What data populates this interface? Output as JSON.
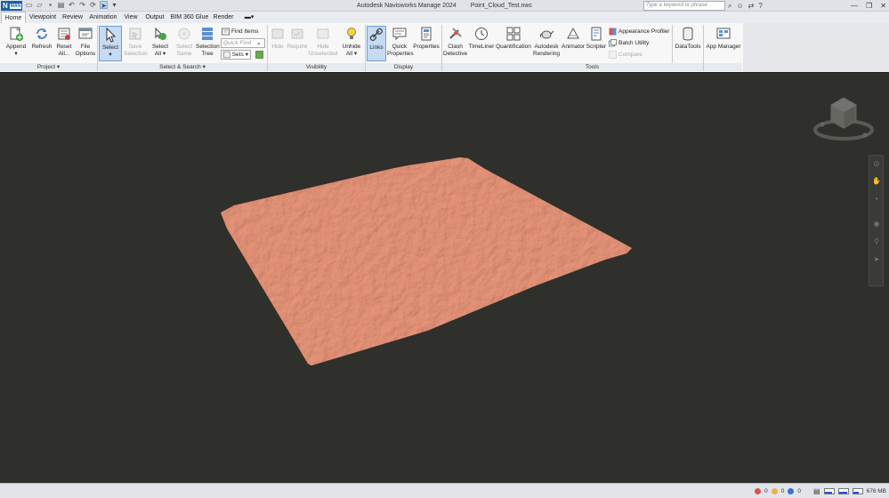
{
  "app": {
    "logo_letter": "N",
    "logo_badge": "MAN",
    "title": "Autodesk Navisworks Manage 2024",
    "file_name": "Point_Cloud_Test.nwc",
    "search_placeholder": "Type a keyword or phrase"
  },
  "tabs": [
    "Home",
    "Viewpoint",
    "Review",
    "Animation",
    "View",
    "Output",
    "BIM 360 Glue",
    "Render"
  ],
  "active_tab": "Home",
  "ribbon": {
    "groups": {
      "project": "Project ▾",
      "select_search": "Select & Search ▾",
      "visibility": "Visibility",
      "display": "Display",
      "tools": "Tools"
    },
    "buttons": {
      "append": "Append\n▾",
      "refresh": "Refresh",
      "reset_all": "Reset\nAll...",
      "file_options": "File\nOptions",
      "select": "Select\n▾",
      "save_selection": "Save\nSelection",
      "select_all": "Select\nAll ▾",
      "select_same": "Select\nSame",
      "selection_tree": "Selection\nTree",
      "find_items": "Find Items",
      "quick_find_placeholder": "Quick Find",
      "sets": "Sets",
      "hide": "Hide",
      "require": "Require",
      "hide_unselected": "Hide\nUnselected",
      "unhide_all": "Unhide\nAll ▾",
      "links": "Links",
      "quick_properties": "Quick\nProperties",
      "properties": "Properties",
      "clash_detective": "Clash\nDetective",
      "timeliner": "TimeLiner",
      "quantification": "Quantification",
      "autodesk_rendering": "Autodesk\nRendering",
      "animator": "Animator",
      "scripter": "Scripter",
      "appearance_profiler": "Appearance Profiler",
      "batch_utility": "Batch Utility",
      "compare": "Compare",
      "datatools": "DataTools",
      "app_manager": "App Manager"
    }
  },
  "status": {
    "errors": "0",
    "warnings": "0",
    "info": "0",
    "memory": "676 MB"
  },
  "colors": {
    "accent": "#6b9fd8",
    "viewport_bg": "#2f2f2b",
    "terrain": "#e0876b"
  }
}
